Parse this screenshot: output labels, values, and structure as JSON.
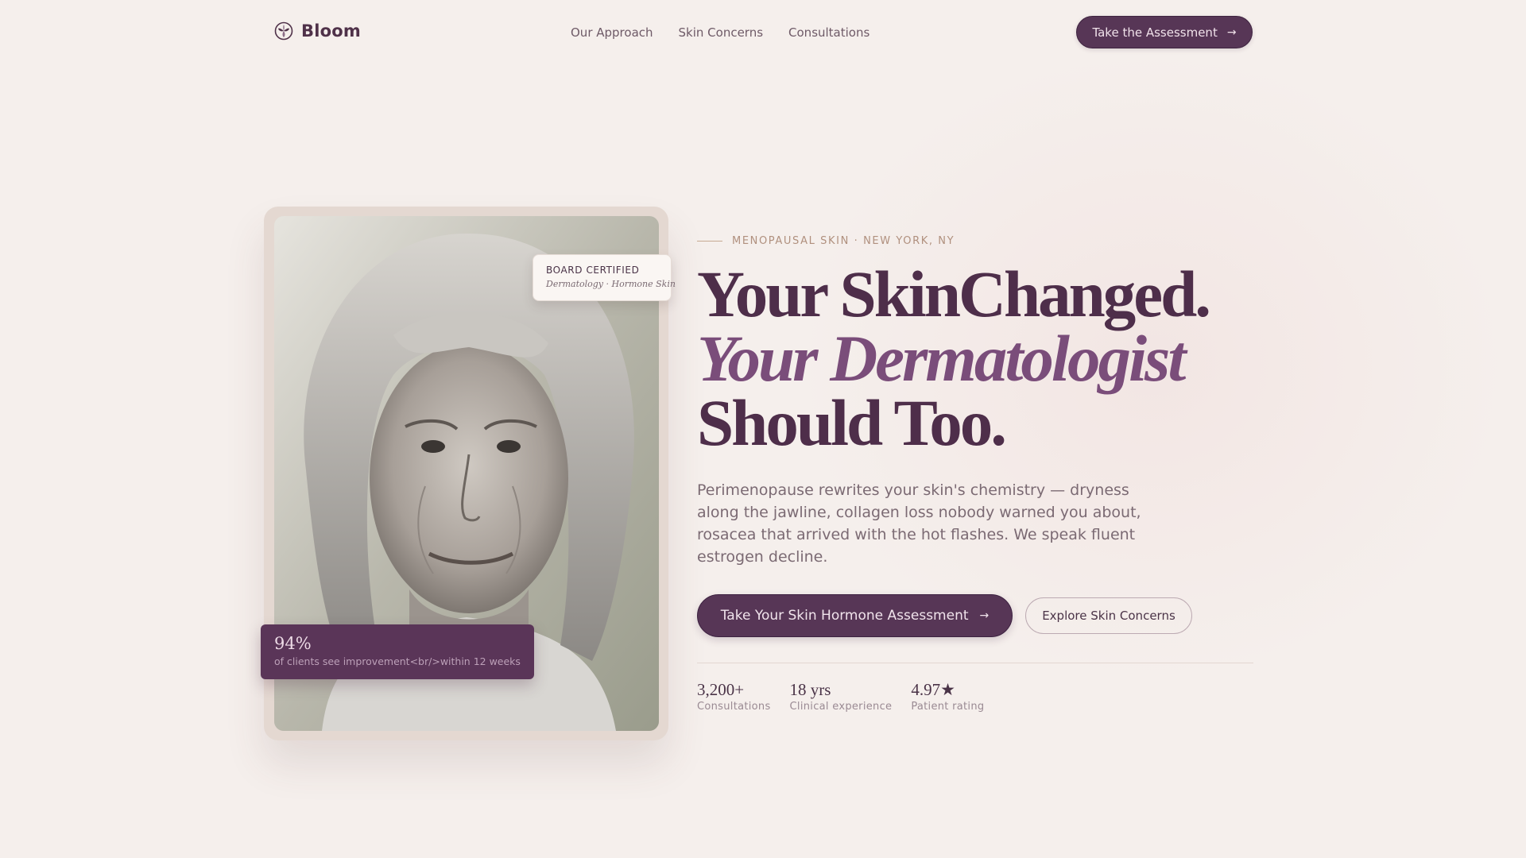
{
  "nav": {
    "brand": "Bloom",
    "links": [
      "Our Approach",
      "Skin Concerns",
      "Consultations"
    ],
    "cta_label": "Take the Assessment",
    "cta_icon": "arrow-right-icon"
  },
  "photo": {
    "cert_badge": {
      "title": "BOARD CERTIFIED",
      "subtitle": "Dermatology · Hormone Skin"
    },
    "stat_card": {
      "value": "94%",
      "text": "of clients see improvement<br/>within 12 weeks"
    }
  },
  "hero": {
    "eyebrow": "MENOPAUSAL SKIN · NEW YORK, NY",
    "headline_line1": "Your SkinChanged.",
    "headline_line2": "Your Dermatologist",
    "headline_line3": "Should Too.",
    "intro": "Perimenopause rewrites your skin's chemistry — dryness along the jawline, collagen loss nobody warned you about, rosacea that arrived with the hot flashes. We speak fluent estrogen decline.",
    "primary_cta": "Take Your Skin Hormone Assessment",
    "secondary_cta": "Explore Skin Concerns",
    "stats": [
      {
        "value": "3,200+",
        "label": "Consultations"
      },
      {
        "value": "18 yrs",
        "label": "Clinical experience"
      },
      {
        "value": "4.97★",
        "label": "Patient rating"
      }
    ]
  },
  "colors": {
    "background": "#f5efec",
    "brand_plum": "#573656",
    "accent_italic": "#7a4d7a"
  }
}
